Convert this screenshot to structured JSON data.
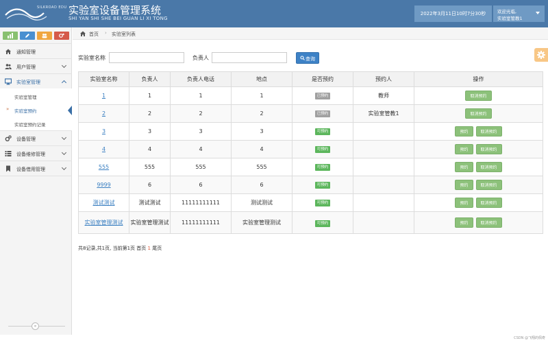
{
  "header": {
    "logo_text": "SILKROAD EDU",
    "title": "实验室设备管理系统",
    "subtitle": "SHI YAN SHI SHE BEI GUAN LI XI TONG",
    "datetime": "2022年3月11日10时7分30秒",
    "welcome": "欢迎光临,",
    "username": "实验室管教1"
  },
  "sidebar": {
    "shortcut_colors": [
      "#88c070",
      "#4a8fd0",
      "#f0a640",
      "#d55a4a"
    ],
    "items": [
      {
        "label": "通知管理",
        "icon": "home-icon"
      },
      {
        "label": "用户管理",
        "icon": "users-icon"
      },
      {
        "label": "实验室管理",
        "icon": "desktop-icon"
      },
      {
        "label": "设备管理",
        "icon": "gears-icon"
      },
      {
        "label": "设备维修管理",
        "icon": "list-icon"
      },
      {
        "label": "设备借用管理",
        "icon": "bookmark-icon"
      }
    ],
    "sub_items": [
      {
        "label": "实验室管理"
      },
      {
        "label": "实验室预约"
      },
      {
        "label": "实验室预约记录"
      }
    ]
  },
  "breadcrumb": {
    "home": "首页",
    "separator": "›",
    "current": "实验室列表"
  },
  "search": {
    "lab_name_label": "实验室名称",
    "lab_name_value": "",
    "person_label": "负责人",
    "person_value": "",
    "button_label": "查询"
  },
  "table": {
    "headers": [
      "实验室名称",
      "负责人",
      "负责人电话",
      "地点",
      "是否预约",
      "预约人",
      "操作"
    ],
    "rows": [
      {
        "name": "1",
        "person": "1",
        "phone": "1",
        "location": "1",
        "status": "已预约",
        "booker": "教师",
        "actions": [
          "取消预约"
        ]
      },
      {
        "name": "2",
        "person": "2",
        "phone": "2",
        "location": "2",
        "status": "已预约",
        "booker": "实验室管教1",
        "actions": [
          "取消预约"
        ]
      },
      {
        "name": "3",
        "person": "3",
        "phone": "3",
        "location": "3",
        "status": "可预约",
        "booker": "",
        "actions": [
          "预约",
          "取消预约"
        ]
      },
      {
        "name": "4",
        "person": "4",
        "phone": "4",
        "location": "4",
        "status": "可预约",
        "booker": "",
        "actions": [
          "预约",
          "取消预约"
        ]
      },
      {
        "name": "555",
        "person": "555",
        "phone": "555",
        "location": "555",
        "status": "可预约",
        "booker": "",
        "actions": [
          "预约",
          "取消预约"
        ]
      },
      {
        "name": "9999",
        "person": "6",
        "phone": "6",
        "location": "6",
        "status": "可预约",
        "booker": "",
        "actions": [
          "预约",
          "取消预约"
        ]
      },
      {
        "name": "测试测试",
        "person": "测试测试",
        "phone": "11111111111",
        "location": "测试测试",
        "status": "可预约",
        "booker": "",
        "actions": [
          "预约",
          "取消预约"
        ]
      },
      {
        "name": "实验室管理测试",
        "person": "实验室管理测试",
        "phone": "11111111111",
        "location": "实验室管理测试",
        "status": "可预约",
        "booker": "",
        "actions": [
          "预约",
          "取消预约"
        ]
      }
    ]
  },
  "pager": {
    "prefix": "共8记录,共1页, 当前第1页 首页 ",
    "current_page": "1",
    "suffix": " 尾页"
  },
  "watermark": "CSDN @飞翔的佩奇"
}
